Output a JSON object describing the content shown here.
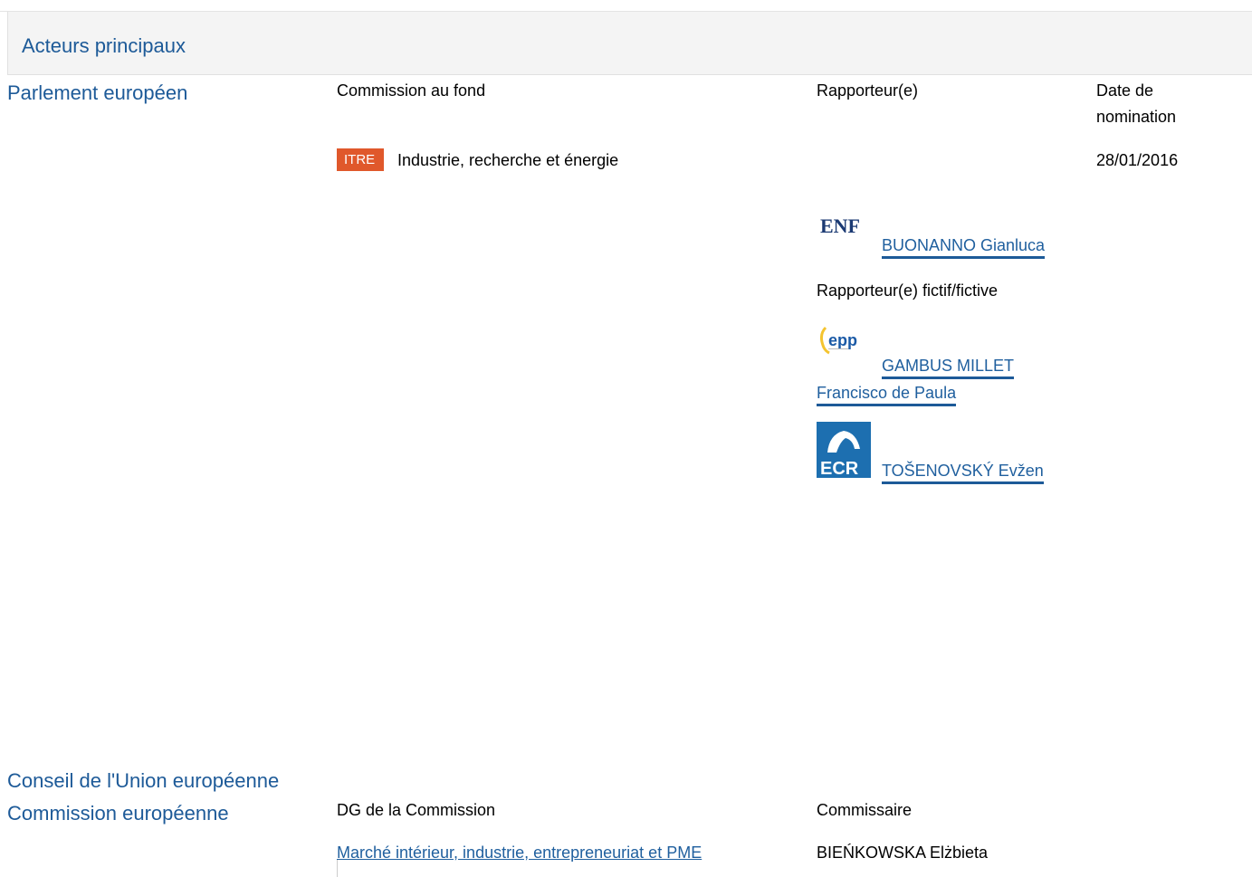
{
  "header": {
    "title": "Acteurs principaux"
  },
  "parliament": {
    "label": "Parlement européen",
    "columns": {
      "committee": "Commission au fond",
      "rapporteur": "Rapporteur(e)",
      "date": "Date de nomination"
    },
    "committee": {
      "code": "ITRE",
      "name": "Industrie, recherche et énergie",
      "date": "28/01/2016",
      "code_color": "#e0582b"
    },
    "rapporteur": {
      "group_logo": "ENF",
      "name": "BUONANNO Gianluca"
    },
    "shadow_label": "Rapporteur(e) fictif/fictive",
    "shadows": [
      {
        "group_logo": "epp",
        "name_line1": "GAMBUS MILLET",
        "name_line2": "Francisco de Paula"
      },
      {
        "group_logo": "ECR",
        "name": "TOŠENOVSKÝ Evžen"
      }
    ]
  },
  "council": {
    "label": "Conseil de l'Union européenne"
  },
  "commission": {
    "label": "Commission européenne",
    "columns": {
      "dg": "DG de la Commission",
      "commissioner": "Commissaire"
    },
    "dg": "Marché intérieur, industrie, entrepreneuriat et PME",
    "commissioner": "BIEŃKOWSKA Elżbieta"
  },
  "colors": {
    "link": "#1d5a98",
    "header_bg": "#f4f4f4"
  }
}
